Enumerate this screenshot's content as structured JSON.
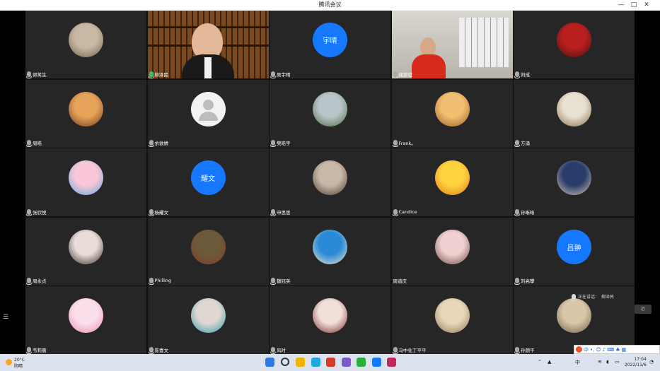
{
  "window": {
    "title": "腾讯会议",
    "controls": [
      "—",
      "□",
      "✕"
    ]
  },
  "participants": [
    {
      "name": "郭笑生",
      "mic": "muted",
      "avatar": {
        "kind": "image",
        "icon": "cat-photo",
        "colors": [
          "#c9b9a4",
          "#6f5d4c"
        ]
      }
    },
    {
      "name": "柳泽民",
      "mic": "on",
      "avatar": {
        "kind": "video",
        "icon": "bookshelf-video"
      }
    },
    {
      "name": "吴宇晴",
      "mic": "muted",
      "avatar": {
        "kind": "text",
        "text": "宇晴"
      }
    },
    {
      "name": "储晋谊",
      "mic": "muted",
      "avatar": {
        "kind": "video",
        "icon": "office-video"
      }
    },
    {
      "name": "刘成",
      "mic": "muted",
      "avatar": {
        "kind": "image",
        "icon": "red-star-badge",
        "colors": [
          "#b91f1f",
          "#4a1010"
        ]
      }
    },
    {
      "name": "周皓",
      "mic": "muted",
      "avatar": {
        "kind": "image",
        "icon": "cartoon-girl",
        "colors": [
          "#e7a35a",
          "#6b3a1a"
        ]
      }
    },
    {
      "name": "余敦婧",
      "mic": "muted",
      "avatar": {
        "kind": "default",
        "icon": "person-icon"
      }
    },
    {
      "name": "樊皓宇",
      "mic": "muted",
      "avatar": {
        "kind": "image",
        "icon": "landscape-photo",
        "colors": [
          "#b8c4c8",
          "#4c6b3f"
        ]
      }
    },
    {
      "name": "Frank。",
      "mic": "muted",
      "avatar": {
        "kind": "image",
        "icon": "cartoon-mouse",
        "colors": [
          "#f0c070",
          "#a05a20"
        ]
      }
    },
    {
      "name": "方涌",
      "mic": "muted",
      "avatar": {
        "kind": "image",
        "icon": "cat-photo",
        "colors": [
          "#e8e0d0",
          "#8a6b4a"
        ]
      }
    },
    {
      "name": "张欣悦",
      "mic": "muted",
      "avatar": {
        "kind": "image",
        "icon": "cartoon-kid",
        "colors": [
          "#f9c7d7",
          "#5aa7e0"
        ]
      }
    },
    {
      "name": "杨耀文",
      "mic": "muted",
      "avatar": {
        "kind": "text",
        "text": "耀文"
      }
    },
    {
      "name": "申思思",
      "mic": "muted",
      "avatar": {
        "kind": "image",
        "icon": "street-photo",
        "colors": [
          "#c8b8a8",
          "#4a3a30"
        ]
      }
    },
    {
      "name": "Candice",
      "mic": "muted",
      "avatar": {
        "kind": "image",
        "icon": "cartoon-tiger",
        "colors": [
          "#ffd23f",
          "#e07a1a"
        ]
      }
    },
    {
      "name": "孙晰晰",
      "mic": "muted",
      "avatar": {
        "kind": "image",
        "icon": "person-photo",
        "colors": [
          "#2a3d6a",
          "#d8c8b8"
        ]
      }
    },
    {
      "name": "周永贞",
      "mic": "muted",
      "avatar": {
        "kind": "image",
        "icon": "child-photo",
        "colors": [
          "#e8ddd8",
          "#3a2a28"
        ]
      }
    },
    {
      "name": "Philling",
      "mic": "muted",
      "avatar": {
        "kind": "image",
        "icon": "nature-photo",
        "colors": [
          "#6a5a3a",
          "#8a3a2a"
        ]
      }
    },
    {
      "name": "魏钰英",
      "mic": "muted",
      "avatar": {
        "kind": "image",
        "icon": "doraemon",
        "colors": [
          "#2a8ad8",
          "#f5e8c8"
        ]
      }
    },
    {
      "name": "周道庆",
      "mic": "none",
      "avatar": {
        "kind": "image",
        "icon": "child-photo",
        "colors": [
          "#f0d0d0",
          "#6a4a40"
        ]
      }
    },
    {
      "name": "刘高攀",
      "mic": "muted",
      "avatar": {
        "kind": "text",
        "text": "吕翀"
      }
    },
    {
      "name": "韦莉晨",
      "mic": "muted",
      "avatar": {
        "kind": "image",
        "icon": "cartoon-kirby",
        "colors": [
          "#fbe0ec",
          "#e88fb0"
        ]
      }
    },
    {
      "name": "陈壹文",
      "mic": "muted",
      "avatar": {
        "kind": "image",
        "icon": "child-photo",
        "colors": [
          "#e0d8d0",
          "#2a9aa8"
        ]
      }
    },
    {
      "name": "风时",
      "mic": "muted",
      "avatar": {
        "kind": "image",
        "icon": "anime-figure",
        "colors": [
          "#f0e0d8",
          "#7a2a2a"
        ]
      }
    },
    {
      "name": "马中化丁平平",
      "mic": "muted",
      "avatar": {
        "kind": "image",
        "icon": "doorway-photo",
        "colors": [
          "#e8d8b8",
          "#8a7a5a"
        ]
      }
    },
    {
      "name": "孙朗平",
      "mic": "muted",
      "avatar": {
        "kind": "image",
        "icon": "dog-photo",
        "colors": [
          "#d8c8a8",
          "#6a5a4a"
        ]
      }
    }
  ],
  "speaking": {
    "label": "正在讲话：",
    "name": "柳泽民"
  },
  "ime": {
    "label": "中",
    "icons": [
      "sogou-icon",
      "punctuation-icon",
      "emoji-icon",
      "mic-icon",
      "keyboard-icon",
      "skin-icon",
      "toolbox-icon"
    ]
  },
  "taskbar": {
    "weather": {
      "temp": "20°C",
      "desc": "阴晴"
    },
    "apps": [
      "windows-start-icon",
      "search-icon",
      "file-explorer-icon",
      "edge-icon",
      "wps-icon",
      "photos-icon",
      "wechat-icon",
      "tencent-meeting-icon",
      "app-star-icon"
    ],
    "app_colors": [
      "#2c7be5",
      "#444",
      "#f0b400",
      "#1ea7e0",
      "#d83a2a",
      "#7a5ac8",
      "#2ab03a",
      "#1677ff",
      "#c02a5a"
    ],
    "tray": {
      "ime": "中",
      "time": "17:04",
      "date": "2022/11/6"
    }
  }
}
